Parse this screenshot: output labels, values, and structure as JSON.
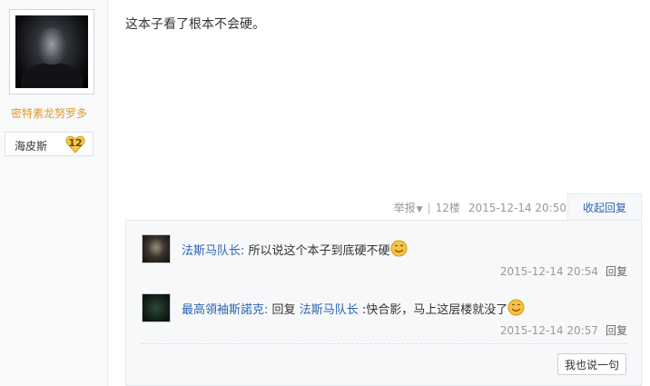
{
  "author": {
    "name": "密特素龙努罗多",
    "badge_text": "海皮斯",
    "badge_level": "12"
  },
  "post": {
    "content": "这本子看了根本不会硬。",
    "report_label": "举报",
    "separator": "|",
    "floor": "12楼",
    "time": "2015-12-14 20:50",
    "collapse_label": "收起回复"
  },
  "replies": [
    {
      "name": "法斯马队长",
      "colon": ":",
      "text": "所以说这个本子到底硬不硬",
      "reply_to": "",
      "time": "2015-12-14 20:54",
      "reply_label": "回复"
    },
    {
      "name": "最高領袖斯諾克",
      "colon": ":",
      "prefix": "回复",
      "reply_to": "法斯马队长",
      "text": ":快合影，马上这层楼就没了",
      "time": "2015-12-14 20:57",
      "reply_label": "回复"
    }
  ],
  "compose_button": "我也说一句",
  "colors": {
    "link": "#2d64b3",
    "username": "#e29a2c",
    "meta": "#999999"
  }
}
